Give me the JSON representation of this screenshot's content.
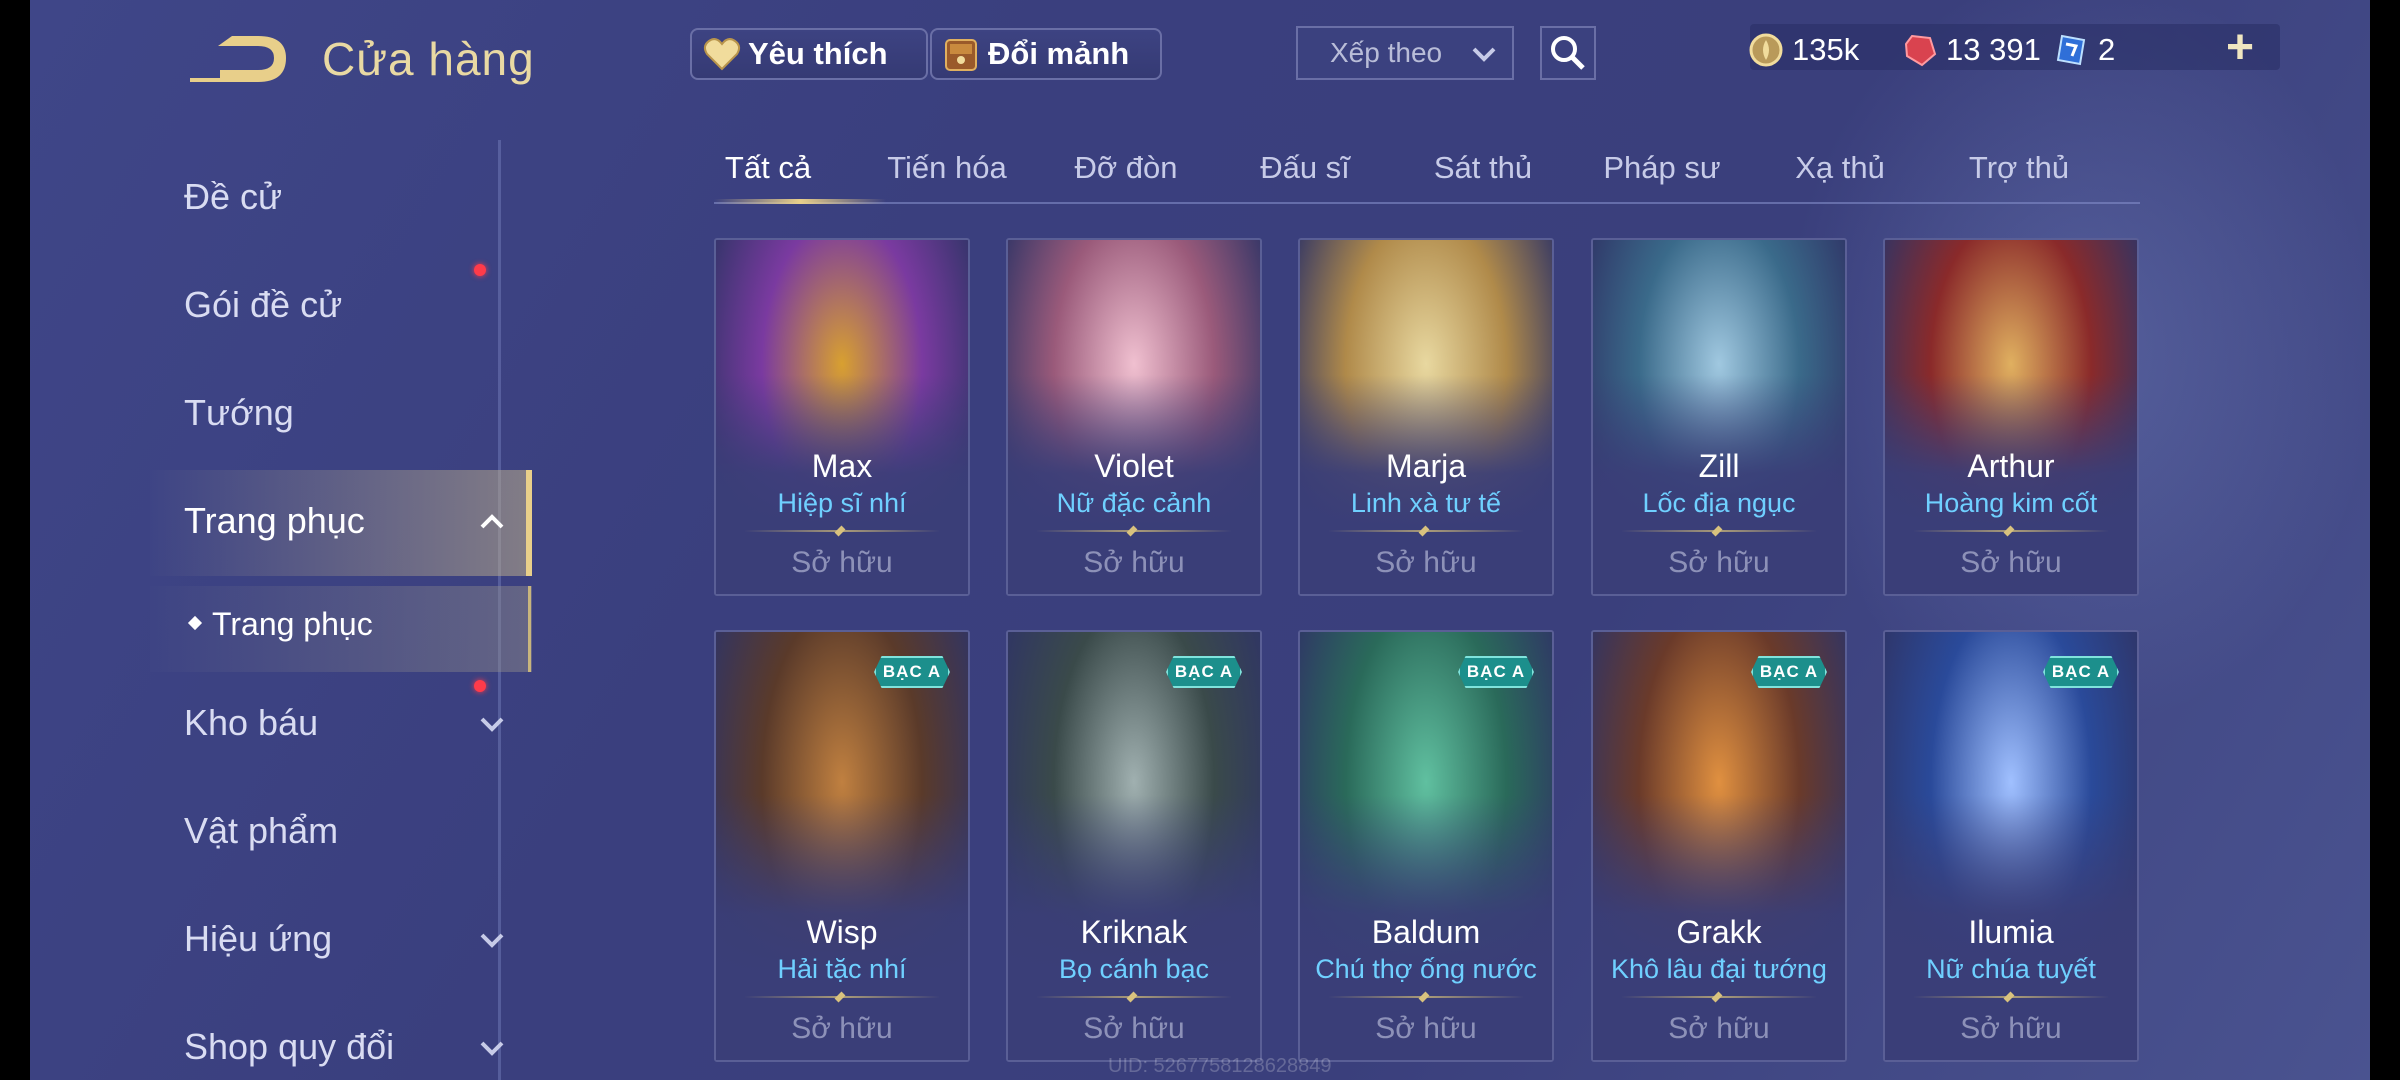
{
  "header": {
    "title": "Cửa hàng",
    "favorites_label": "Yêu thích",
    "shard_label": "Đổi mảnh",
    "sort_label": "Xếp theo",
    "currencies": [
      {
        "name": "gold-coin",
        "value": "135k",
        "color": "#e8cf8a"
      },
      {
        "name": "ruby",
        "value": "13 391",
        "color": "#e4505a"
      },
      {
        "name": "ticket",
        "value": "2",
        "color": "#5aa8ff"
      }
    ]
  },
  "sidebar": {
    "items": [
      {
        "label": "Đề cử"
      },
      {
        "label": "Gói đề cử"
      },
      {
        "label": "Tướng"
      },
      {
        "label": "Trang phục"
      },
      {
        "label": "Trang phục"
      },
      {
        "label": "Kho báu"
      },
      {
        "label": "Vật phẩm"
      },
      {
        "label": "Hiệu ứng"
      },
      {
        "label": "Shop quy đổi"
      }
    ]
  },
  "tabs": [
    "Tất cả",
    "Tiến hóa",
    "Đỡ đòn",
    "Đấu sĩ",
    "Sát thủ",
    "Pháp sư",
    "Xạ thủ",
    "Trợ thủ"
  ],
  "cards": [
    {
      "hero": "Max",
      "skin": "Hiệp sĩ nhí",
      "status": "Sở hữu",
      "badge": ""
    },
    {
      "hero": "Violet",
      "skin": "Nữ đặc cảnh",
      "status": "Sở hữu",
      "badge": ""
    },
    {
      "hero": "Marja",
      "skin": "Linh xà tư tế",
      "status": "Sở hữu",
      "badge": ""
    },
    {
      "hero": "Zill",
      "skin": "Lốc địa ngục",
      "status": "Sở hữu",
      "badge": ""
    },
    {
      "hero": "Arthur",
      "skin": "Hoàng kim cốt",
      "status": "Sở hữu",
      "badge": ""
    },
    {
      "hero": "Wisp",
      "skin": "Hải tặc nhí",
      "status": "Sở hữu",
      "badge": "BẠC A"
    },
    {
      "hero": "Kriknak",
      "skin": "Bọ cánh bạc",
      "status": "Sở hữu",
      "badge": "BẠC A"
    },
    {
      "hero": "Baldum",
      "skin": "Chú thợ ống nước",
      "status": "Sở hữu",
      "badge": "BẠC A"
    },
    {
      "hero": "Grakk",
      "skin": "Khô lâu đại tướng",
      "status": "Sở hữu",
      "badge": "BẠC A"
    },
    {
      "hero": "Ilumia",
      "skin": "Nữ chúa tuyết",
      "status": "Sở hữu",
      "badge": "BẠC A"
    }
  ],
  "uid_text": "UID: 5267758128628849",
  "colors": {
    "accent_gold": "#e8cf8a",
    "skin_name": "#6fd0ff",
    "badge_teal": "#1c8f8c",
    "notification_red": "#ff3b4a"
  }
}
